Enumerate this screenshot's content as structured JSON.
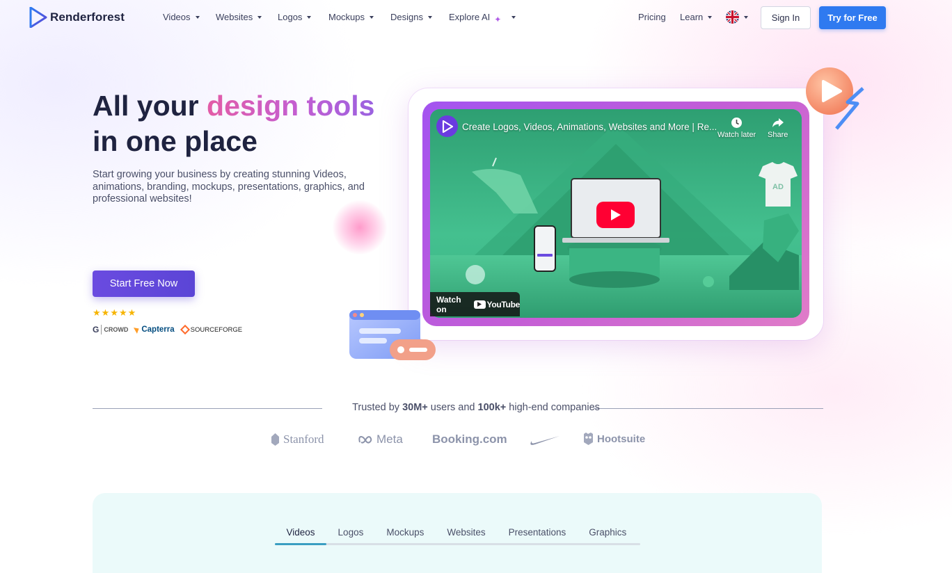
{
  "header": {
    "brand": "Renderforest",
    "nav": [
      {
        "label": "Videos"
      },
      {
        "label": "Websites"
      },
      {
        "label": "Logos"
      },
      {
        "label": "Mockups"
      },
      {
        "label": "Designs"
      },
      {
        "label": "Explore AI"
      }
    ],
    "pricing": "Pricing",
    "learn": "Learn",
    "language_icon": "uk-flag-icon",
    "sign_in": "Sign In",
    "try_free": "Try for Free"
  },
  "hero": {
    "title_part1": "All your ",
    "title_accent": "design tools",
    "title_line2": "in one place",
    "subtitle": "Start growing your business by creating stunning Videos, animations, branding, mockups, presentations, graphics, and professional websites!",
    "cta": "Start Free Now",
    "rating_stars": 5,
    "review_sites": [
      "CROWD",
      "Capterra",
      "SOURCEFORGE"
    ]
  },
  "video": {
    "title": "Create Logos, Videos, Animations, Websites and More | Re...",
    "watch_later": "Watch later",
    "share": "Share",
    "watch_on": "Watch on",
    "youtube": "YouTube",
    "shirt_text": "AD"
  },
  "trusted": {
    "prefix": "Trusted by ",
    "users": "30M+",
    "middle": " users and ",
    "companies": "100k+",
    "suffix": " high-end companies",
    "brands": [
      "Stanford",
      "Meta",
      "Booking.com",
      "Nike",
      "Hootsuite"
    ]
  },
  "tabs": [
    "Videos",
    "Logos",
    "Mockups",
    "Websites",
    "Presentations",
    "Graphics"
  ],
  "colors": {
    "accent_blue": "#2f7af0",
    "cta_purple": "#5b45d6",
    "accent_pink": "#e35ca6",
    "tab_indicator": "#3a9ec2"
  }
}
